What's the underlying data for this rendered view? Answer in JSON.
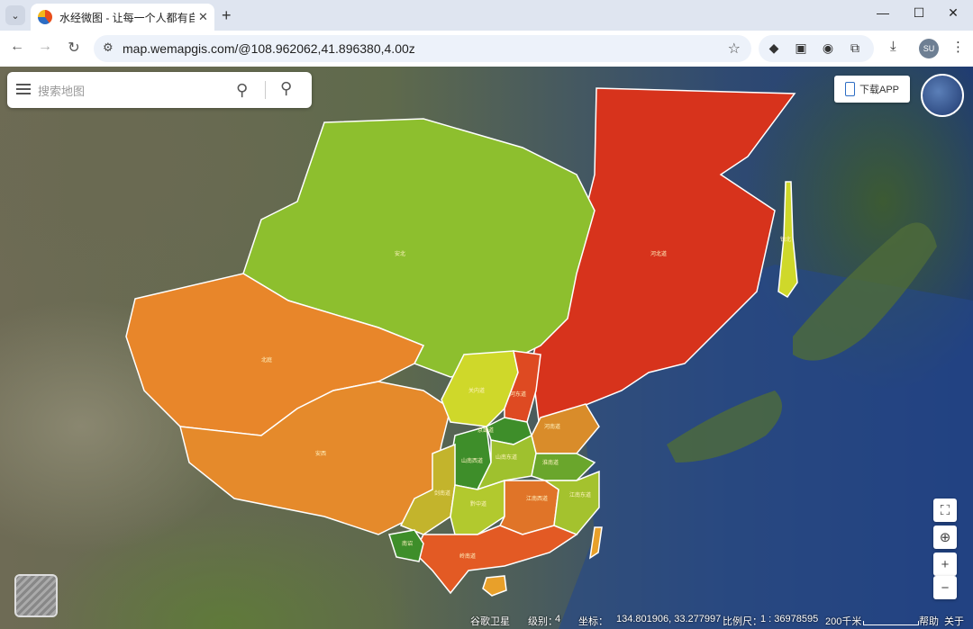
{
  "browser": {
    "tab_title": "水经微图 - 让每一个人都有自己",
    "url": "map.wemapgis.com/@108.962062,41.896380,4.00z",
    "avatar_text": "SU"
  },
  "map": {
    "search_placeholder": "搜索地图",
    "download_app": "下载APP",
    "region_labels": [
      "安北",
      "河北道",
      "镇北",
      "北庭",
      "安西",
      "陇右",
      "关内道",
      "河东道",
      "京畿道",
      "河南道",
      "山南西道",
      "山南东道",
      "淮南道",
      "剑南道",
      "黔中道",
      "江南西道",
      "江南东道",
      "岭南道",
      "南诏",
      "安东"
    ]
  },
  "status": {
    "layer_name": "谷歌卫星",
    "level_label": "级别：",
    "level": "4",
    "coord_label": "坐标：",
    "coords": "134.801906, 33.277997",
    "scale_label": "比例尺：",
    "scale": "1 : 36978595",
    "scale_bar": "200千米",
    "help": "帮助",
    "about": "关于"
  },
  "colors": {
    "dark_red": "#d7331c",
    "orange": "#e8862a",
    "yellow_green": "#8dbf2e",
    "lime": "#c9d626",
    "dark_green": "#3e8e2a",
    "amber": "#d98c2a"
  }
}
